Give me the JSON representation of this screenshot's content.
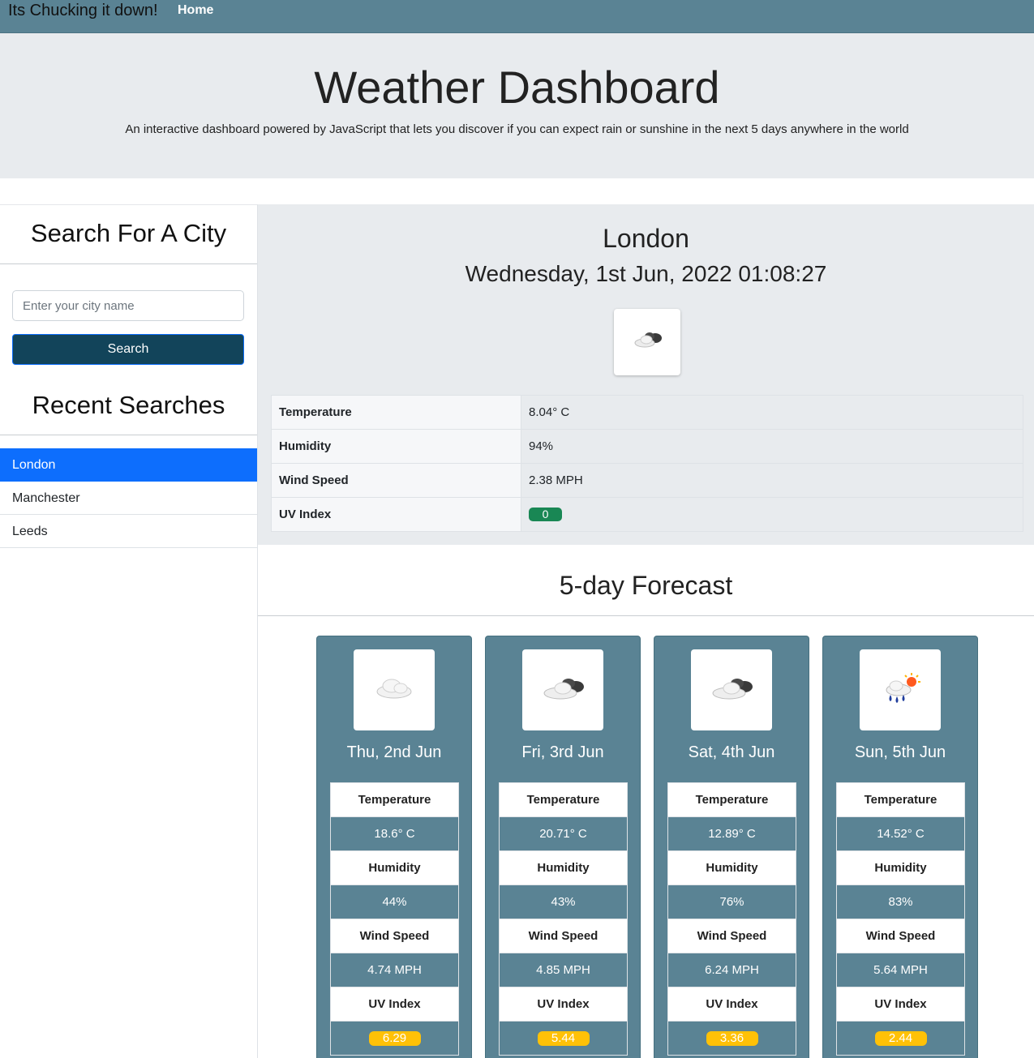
{
  "navbar": {
    "brand": "Its Chucking it down!",
    "home": "Home",
    "bg_color": "#5a8394"
  },
  "header": {
    "title": "Weather Dashboard",
    "subtitle": "An interactive dashboard powered by JavaScript that lets you discover if you can expect rain or sunshine in the next 5 days anywhere in the world"
  },
  "sidebar": {
    "search_title": "Search For A City",
    "input_placeholder": "Enter your city name",
    "search_button": "Search",
    "recent_title": "Recent Searches",
    "recent": [
      "London",
      "Manchester",
      "Leeds"
    ],
    "active_color": "#0d6efd"
  },
  "current": {
    "city": "London",
    "datetime": "Wednesday, 1st Jun, 2022 01:08:27",
    "icon": "cloudy-night-icon",
    "labels": {
      "temperature": "Temperature",
      "humidity": "Humidity",
      "wind": "Wind Speed",
      "uv": "UV Index"
    },
    "temperature": "8.04° C",
    "humidity": "94%",
    "wind": "2.38 MPH",
    "uv": "0",
    "uv_color": "#198754"
  },
  "forecast": {
    "title": "5-day Forecast",
    "labels": {
      "temperature": "Temperature",
      "humidity": "Humidity",
      "wind": "Wind Speed",
      "uv": "UV Index"
    },
    "uv_color": "#ffc107",
    "days": [
      {
        "date": "Thu, 2nd Jun",
        "icon": "cloud-icon",
        "temperature": "18.6° C",
        "humidity": "44%",
        "wind": "4.74 MPH",
        "uv": "6.29"
      },
      {
        "date": "Fri, 3rd Jun",
        "icon": "cloudy-night-icon",
        "temperature": "20.71° C",
        "humidity": "43%",
        "wind": "4.85 MPH",
        "uv": "5.44"
      },
      {
        "date": "Sat, 4th Jun",
        "icon": "cloudy-night-icon",
        "temperature": "12.89° C",
        "humidity": "76%",
        "wind": "6.24 MPH",
        "uv": "3.36"
      },
      {
        "date": "Sun, 5th Jun",
        "icon": "rain-sun-icon",
        "temperature": "14.52° C",
        "humidity": "83%",
        "wind": "5.64 MPH",
        "uv": "2.44"
      }
    ]
  }
}
